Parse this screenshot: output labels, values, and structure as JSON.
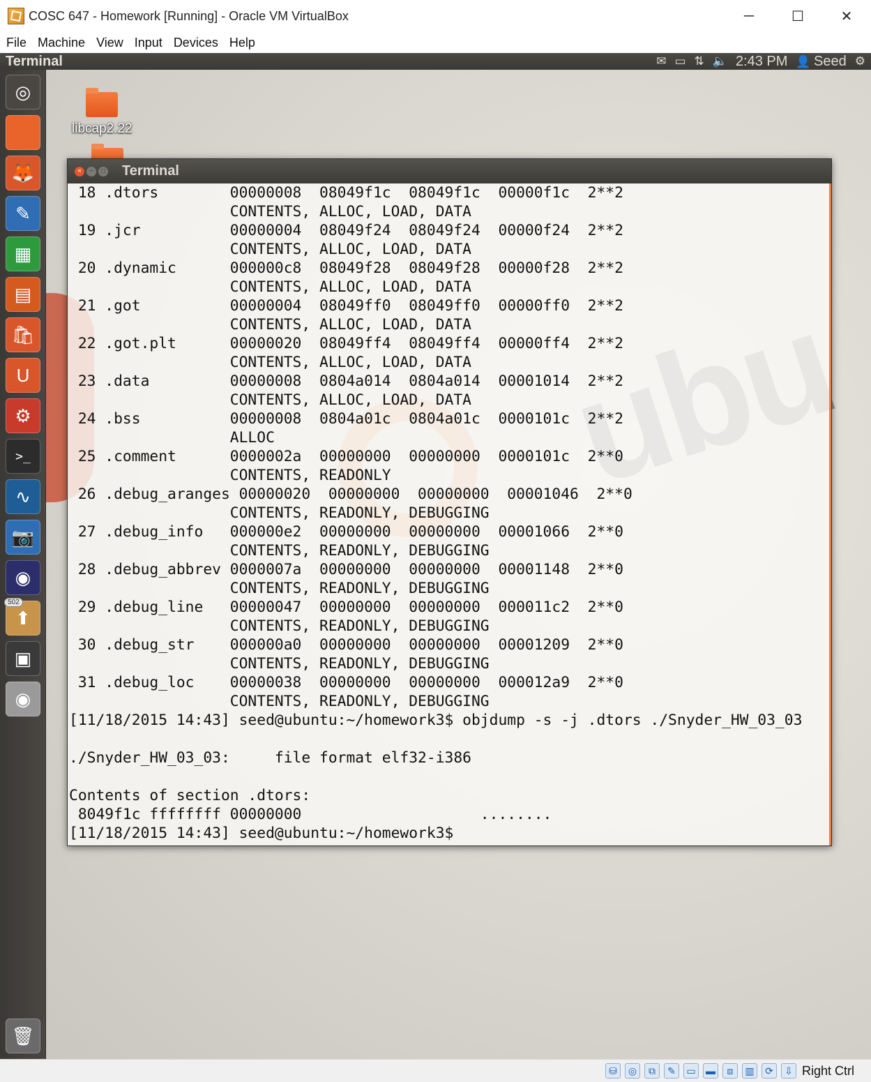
{
  "window": {
    "title": "COSC 647 - Homework [Running] - Oracle VM VirtualBox",
    "minimize_glyph": "─",
    "maximize_glyph": "☐",
    "close_glyph": "✕"
  },
  "menubar": {
    "items": [
      "File",
      "Machine",
      "View",
      "Input",
      "Devices",
      "Help"
    ]
  },
  "ubuntu_panel": {
    "app_title": "Terminal",
    "icons": [
      "mail-icon",
      "battery-icon",
      "network-icon",
      "volume-icon"
    ],
    "clock": "2:43 PM",
    "user": "Seed",
    "user_glyph": "👤",
    "settings_glyph": "⚙"
  },
  "desktop": {
    "icons": [
      {
        "label": "libcap2.22"
      }
    ],
    "wallpaper_text": "ubu"
  },
  "launcher": {
    "items": [
      {
        "name": "dash",
        "glyph": "◎",
        "color": "#4a4743"
      },
      {
        "name": "files",
        "glyph": "",
        "color": "#e8642a"
      },
      {
        "name": "firefox",
        "glyph": "🦊",
        "color": "#d9562b"
      },
      {
        "name": "writer",
        "glyph": "✎",
        "color": "#2f6eb5"
      },
      {
        "name": "calc",
        "glyph": "▦",
        "color": "#2e9a3e"
      },
      {
        "name": "impress",
        "glyph": "▤",
        "color": "#d55a1e"
      },
      {
        "name": "software-center",
        "glyph": "🛍",
        "color": "#d9562b"
      },
      {
        "name": "ubuntu-one",
        "glyph": "U",
        "color": "#d9562b"
      },
      {
        "name": "system-settings",
        "glyph": "⚙",
        "color": "#c83a2a"
      },
      {
        "name": "terminal",
        "glyph": ">_",
        "color": "#2c2c2c"
      },
      {
        "name": "wireshark",
        "glyph": "∿",
        "color": "#1e5d96"
      },
      {
        "name": "screenshot",
        "glyph": "📷",
        "color": "#2f6eb5"
      },
      {
        "name": "eclipse",
        "glyph": "◉",
        "color": "#2b2e6a"
      },
      {
        "name": "updates",
        "glyph": "⬆",
        "color": "#c8944a",
        "badge": "502"
      },
      {
        "name": "workspaces",
        "glyph": "▣",
        "color": "#3a3a3a"
      },
      {
        "name": "dvd",
        "glyph": "◉",
        "color": "#9a9a9a"
      },
      {
        "name": "trash",
        "glyph": "🗑",
        "color": "#6a6a6a"
      }
    ]
  },
  "terminal": {
    "title": "Terminal",
    "lines": [
      " 18 .dtors        00000008  08049f1c  08049f1c  00000f1c  2**2",
      "                  CONTENTS, ALLOC, LOAD, DATA",
      " 19 .jcr          00000004  08049f24  08049f24  00000f24  2**2",
      "                  CONTENTS, ALLOC, LOAD, DATA",
      " 20 .dynamic      000000c8  08049f28  08049f28  00000f28  2**2",
      "                  CONTENTS, ALLOC, LOAD, DATA",
      " 21 .got          00000004  08049ff0  08049ff0  00000ff0  2**2",
      "                  CONTENTS, ALLOC, LOAD, DATA",
      " 22 .got.plt      00000020  08049ff4  08049ff4  00000ff4  2**2",
      "                  CONTENTS, ALLOC, LOAD, DATA",
      " 23 .data         00000008  0804a014  0804a014  00001014  2**2",
      "                  CONTENTS, ALLOC, LOAD, DATA",
      " 24 .bss          00000008  0804a01c  0804a01c  0000101c  2**2",
      "                  ALLOC",
      " 25 .comment      0000002a  00000000  00000000  0000101c  2**0",
      "                  CONTENTS, READONLY",
      " 26 .debug_aranges 00000020  00000000  00000000  00001046  2**0",
      "                  CONTENTS, READONLY, DEBUGGING",
      " 27 .debug_info   000000e2  00000000  00000000  00001066  2**0",
      "                  CONTENTS, READONLY, DEBUGGING",
      " 28 .debug_abbrev 0000007a  00000000  00000000  00001148  2**0",
      "                  CONTENTS, READONLY, DEBUGGING",
      " 29 .debug_line   00000047  00000000  00000000  000011c2  2**0",
      "                  CONTENTS, READONLY, DEBUGGING",
      " 30 .debug_str    000000a0  00000000  00000000  00001209  2**0",
      "                  CONTENTS, READONLY, DEBUGGING",
      " 31 .debug_loc    00000038  00000000  00000000  000012a9  2**0",
      "                  CONTENTS, READONLY, DEBUGGING",
      "[11/18/2015 14:43] seed@ubuntu:~/homework3$ objdump -s -j .dtors ./Snyder_HW_03_03",
      "",
      "./Snyder_HW_03_03:     file format elf32-i386",
      "",
      "Contents of section .dtors:",
      " 8049f1c ffffffff 00000000                    ........",
      "[11/18/2015 14:43] seed@ubuntu:~/homework3$ "
    ]
  },
  "statusbar": {
    "icons": [
      "hdd-icon",
      "optical-icon",
      "network-adapter-icon",
      "usb-icon",
      "shared-folder-icon",
      "display-icon",
      "video-capture-icon",
      "cpu-icon",
      "guest-additions-icon",
      "mouse-integration-icon"
    ],
    "icon_glyphs": [
      "⛁",
      "◎",
      "⧉",
      "✎",
      "▭",
      "▬",
      "⧈",
      "▥",
      "⟳",
      "⇩"
    ],
    "host_key": "Right Ctrl"
  }
}
